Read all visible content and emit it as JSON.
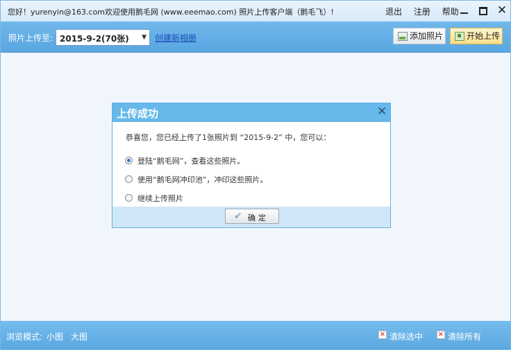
{
  "titlebar": {
    "title": "您好！yurenyin@163.com欢迎使用鹅毛网 (www.eeemao.com) 照片上传客户端（鹅毛飞）!",
    "links": [
      "退出",
      "注册",
      "帮助"
    ],
    "minimize": "minimize",
    "maximize": "maximize",
    "close": "✕"
  },
  "toolbar": {
    "upload_to_label": "照片上传至:",
    "album_selected": "2015-9-2(70张)",
    "new_album_link": "创建新相册",
    "add_photos_label": "添加照片",
    "start_upload_label": "开始上传"
  },
  "dialog": {
    "title": "上传成功",
    "close": "✕",
    "message": "恭喜您，您已经上传了1张照片到 “2015-9-2” 中，您可以：",
    "options": [
      {
        "label": "登陆“鹅毛网”，查看这些照片。",
        "selected": true
      },
      {
        "label": "使用“鹅毛网冲印池”，冲印这些照片。",
        "selected": false
      },
      {
        "label": "继续上传照片",
        "selected": false
      }
    ],
    "ok_label": "确定"
  },
  "statusbar": {
    "browse_mode_label": "浏览模式:",
    "small_view": "小图",
    "large_view": "大图",
    "clear_selected": "清除选中",
    "clear_all": "清除所有"
  },
  "colors": {
    "toolbar_blue": "#5aa7e0",
    "dialog_header": "#66b9ea",
    "link_blue": "#1c4fb6"
  }
}
